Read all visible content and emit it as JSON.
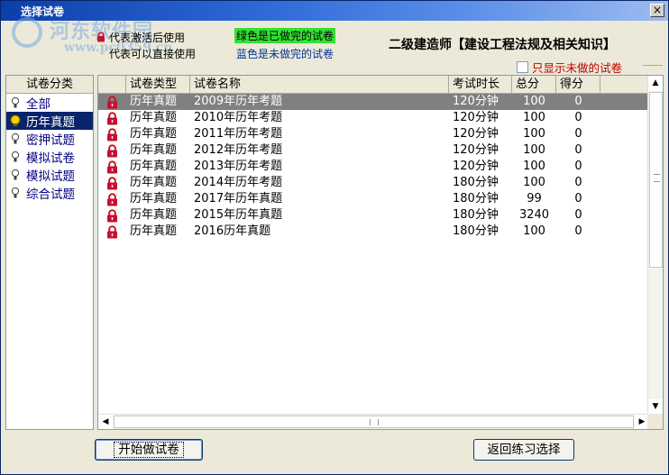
{
  "window": {
    "title": "选择试卷",
    "close_label": "×"
  },
  "watermark": {
    "text": "河东软件园",
    "url": "www.pc0359.cn"
  },
  "legend": {
    "locked_text": "代表激活后使用",
    "open_text": "代表可以直接使用",
    "green_text": "绿色是已做完的试卷",
    "blue_text": "蓝色是未做完的试卷"
  },
  "course_title": "二级建造师【建设工程法规及相关知识】",
  "filter": {
    "only_undone_label": "只显示未做的试卷",
    "checked": false
  },
  "sidebar": {
    "header": "试卷分类",
    "items": [
      {
        "label": "全部",
        "selected": false
      },
      {
        "label": "历年真题",
        "selected": true
      },
      {
        "label": "密押试题",
        "selected": false
      },
      {
        "label": "模拟试卷",
        "selected": false
      },
      {
        "label": "模拟试题",
        "selected": false
      },
      {
        "label": "综合试题",
        "selected": false
      }
    ]
  },
  "grid": {
    "columns": [
      "",
      "试卷类型",
      "试卷名称",
      "考试时长",
      "总分",
      "得分",
      ""
    ],
    "rows": [
      {
        "type": "历年真题",
        "name": "2009年历年考题",
        "duration": "120分钟",
        "total": "100",
        "score": "0",
        "locked": true,
        "selected": true
      },
      {
        "type": "历年真题",
        "name": "2010年历年考题",
        "duration": "120分钟",
        "total": "100",
        "score": "0",
        "locked": true,
        "selected": false
      },
      {
        "type": "历年真题",
        "name": "2011年历年考题",
        "duration": "120分钟",
        "total": "100",
        "score": "0",
        "locked": true,
        "selected": false
      },
      {
        "type": "历年真题",
        "name": "2012年历年考题",
        "duration": "120分钟",
        "total": "100",
        "score": "0",
        "locked": true,
        "selected": false
      },
      {
        "type": "历年真题",
        "name": "2013年历年考题",
        "duration": "120分钟",
        "total": "100",
        "score": "0",
        "locked": true,
        "selected": false
      },
      {
        "type": "历年真题",
        "name": "2014年历年考题",
        "duration": "180分钟",
        "total": "100",
        "score": "0",
        "locked": true,
        "selected": false
      },
      {
        "type": "历年真题",
        "name": "2017年历年真题",
        "duration": "180分钟",
        "total": "99",
        "score": "0",
        "locked": true,
        "selected": false
      },
      {
        "type": "历年真题",
        "name": "2015年历年真题",
        "duration": "180分钟",
        "total": "3240",
        "score": "0",
        "locked": true,
        "selected": false
      },
      {
        "type": "历年真题",
        "name": "2016历年真题",
        "duration": "180分钟",
        "total": "100",
        "score": "0",
        "locked": true,
        "selected": false
      }
    ]
  },
  "buttons": {
    "start_label": "开始做试卷",
    "back_label": "返回练习选择"
  },
  "icons": {
    "lock": "lock-icon",
    "bulb": "bulb-icon",
    "active_bulb": "bulb-lit-icon"
  },
  "colors": {
    "lock_red": "#c8102e",
    "done_green": "#33e033",
    "undone_blue": "#003399",
    "selection": "#0a246a"
  }
}
